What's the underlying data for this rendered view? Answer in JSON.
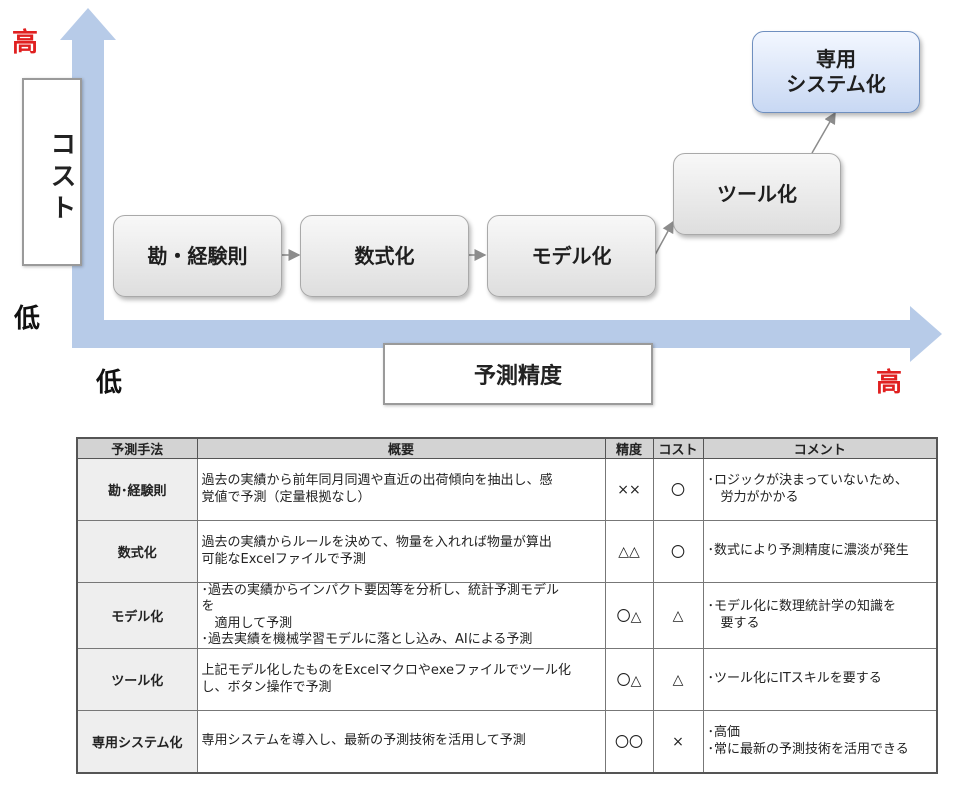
{
  "diagram": {
    "axis_high_y": "高",
    "axis_low_y": "低",
    "axis_low_x": "低",
    "axis_high_x": "高",
    "y_axis_title": "コスト",
    "x_axis_title": "予測精度",
    "steps": [
      {
        "label": "勘・経験則"
      },
      {
        "label": "数式化"
      },
      {
        "label": "モデル化"
      },
      {
        "label": "ツール化"
      },
      {
        "label_line1": "専用",
        "label_line2": "システム化"
      }
    ],
    "colors": {
      "axis": "#b7cbe8",
      "high": "#e02020",
      "highlight_box": "#c8d8f3"
    }
  },
  "table": {
    "headers": [
      "予測手法",
      "概要",
      "精度",
      "コスト",
      "コメント"
    ],
    "rows": [
      {
        "method": "勘･経験則",
        "overview": [
          "過去の実績から前年同月同週や直近の出荷傾向を抽出し、感",
          "覚値で予測（定量根拠なし）"
        ],
        "accuracy": "××",
        "cost": "〇",
        "comment": [
          "･ロジックが決まっていないため、",
          "　労力がかかる"
        ]
      },
      {
        "method": "数式化",
        "overview": [
          "過去の実績からルールを決めて、物量を入れれば物量が算出",
          "可能なExcelファイルで予測"
        ],
        "accuracy": "△△",
        "cost": "〇",
        "comment": [
          "･数式により予測精度に濃淡が発生"
        ]
      },
      {
        "method": "モデル化",
        "overview": [
          "･過去の実績からインパクト要因等を分析し、統計予測モデル",
          "を",
          "　適用して予測",
          "･過去実績を機械学習モデルに落とし込み、AIによる予測"
        ],
        "accuracy": "〇△",
        "cost": "△",
        "comment": [
          "･モデル化に数理統計学の知識を",
          "　要する"
        ]
      },
      {
        "method": "ツール化",
        "overview": [
          "上記モデル化したものをExcelマクロやexeファイルでツール化",
          "し、ボタン操作で予測"
        ],
        "accuracy": "〇△",
        "cost": "△",
        "comment": [
          "･ツール化にITスキルを要する"
        ]
      },
      {
        "method": "専用システム化",
        "overview": [
          "専用システムを導入し、最新の予測技術を活用して予測"
        ],
        "accuracy": "〇〇",
        "cost": "×",
        "comment": [
          "･高価",
          "･常に最新の予測技術を活用できる"
        ]
      }
    ]
  }
}
